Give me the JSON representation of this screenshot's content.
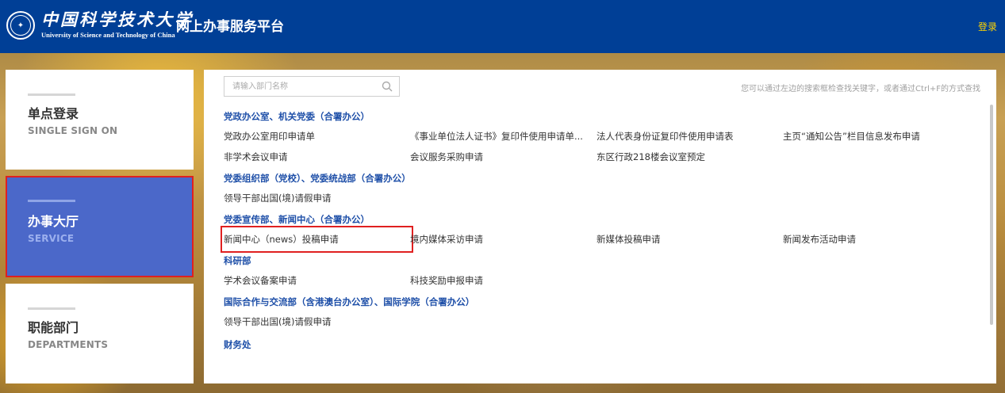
{
  "header": {
    "logo_cn": "中国科学技术大学",
    "logo_en": "University of Science and Technology of China",
    "platform_title": "网上办事服务平台",
    "login_label": "登录",
    "bg_color": "#003f96",
    "login_color": "#ffd400"
  },
  "nav": [
    {
      "cn": "单点登录",
      "en": "SINGLE SIGN ON",
      "active": false
    },
    {
      "cn": "办事大厅",
      "en": "SERVICE",
      "active": true
    },
    {
      "cn": "职能部门",
      "en": "DEPARTMENTS",
      "active": false
    }
  ],
  "search": {
    "placeholder": "请输入部门名称",
    "value": "",
    "hint": "您可以通过左边的搜索框检查找关键字，或者通过Ctrl+F的方式查找"
  },
  "departments": [
    {
      "title": "党政办公室、机关党委（合署办公）",
      "rows": [
        [
          "党政办公室用印申请单",
          "《事业单位法人证书》复印件使用申请单...",
          "法人代表身份证复印件使用申请表",
          "主页“通知公告”栏目信息发布申请"
        ],
        [
          "非学术会议申请",
          "会议服务采购申请",
          "东区行政218楼会议室预定"
        ]
      ]
    },
    {
      "title": "党委组织部（党校）、党委统战部（合署办公）",
      "rows": [
        [
          "领导干部出国(境)请假申请"
        ]
      ]
    },
    {
      "title": "党委宣传部、新闻中心（合署办公）",
      "rows": [
        [
          "新闻中心（news）投稿申请",
          "境内媒体采访申请",
          "新媒体投稿申请",
          "新闻发布活动申请"
        ]
      ]
    },
    {
      "title": "科研部",
      "rows": [
        [
          "学术会议备案申请",
          "科技奖励申报申请"
        ]
      ]
    },
    {
      "title": "国际合作与交流部（含港澳台办公室）、国际学院（合署办公）",
      "rows": [
        [
          "领导干部出国(境)请假申请"
        ]
      ]
    },
    {
      "title": "财务处",
      "rows": []
    }
  ],
  "highlighted_item": "新闻中心（news）投稿申请",
  "colors": {
    "nav_active": "#4b68c9",
    "highlight_border": "#e02020",
    "dept_title": "#1e4fa8"
  }
}
